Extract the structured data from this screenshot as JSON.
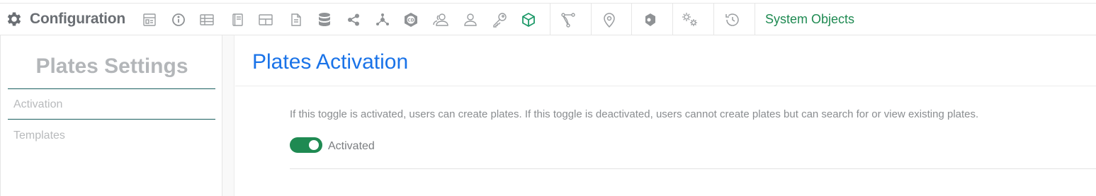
{
  "app": {
    "title": "Configuration",
    "system_objects_link": "System Objects"
  },
  "toolbar": {
    "icons": [
      "dashboard-icon",
      "info-icon",
      "table-icon",
      "book-icon",
      "layout-icon",
      "document-icon",
      "database-icon",
      "share-icon",
      "network-icon",
      "cd-icon",
      "group-icon",
      "user-icon",
      "key-icon",
      "cube-icon",
      "workflow-icon",
      "location-icon",
      "plugin-icon",
      "gears-icon",
      "history-icon"
    ]
  },
  "sidebar": {
    "title": "Plates Settings",
    "items": [
      {
        "label": "Activation",
        "active": true
      },
      {
        "label": "Templates",
        "active": false
      }
    ]
  },
  "main": {
    "title": "Plates Activation",
    "description": "If this toggle is activated, users can create plates. If this toggle is deactivated, users cannot create plates but can search for or view existing plates.",
    "toggle": {
      "state": true,
      "label": "Activated"
    }
  },
  "colors": {
    "accent_green": "#1f8a52",
    "title_blue": "#1a73e8",
    "icon_gray": "#9a9da0",
    "active_icon_teal": "#1f9a6a"
  }
}
